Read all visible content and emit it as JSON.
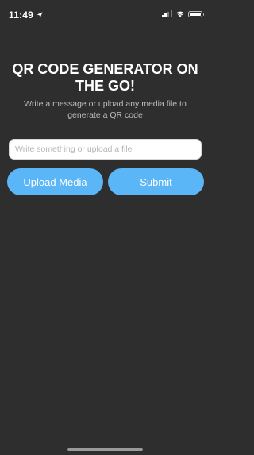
{
  "status_bar": {
    "time": "11:49",
    "location_icon": "location-arrow-icon",
    "signal_icon": "cellular-signal-icon",
    "wifi_icon": "wifi-icon",
    "battery_icon": "battery-icon"
  },
  "header": {
    "title": "QR CODE GENERATOR ON THE GO!",
    "subtitle": "Write a message or upload any media file to generate a QR code"
  },
  "form": {
    "input_value": "",
    "input_placeholder": "Write something or upload a file",
    "upload_label": "Upload Media",
    "submit_label": "Submit"
  },
  "colors": {
    "background": "#2e2e2e",
    "button": "#5ab6f7"
  }
}
